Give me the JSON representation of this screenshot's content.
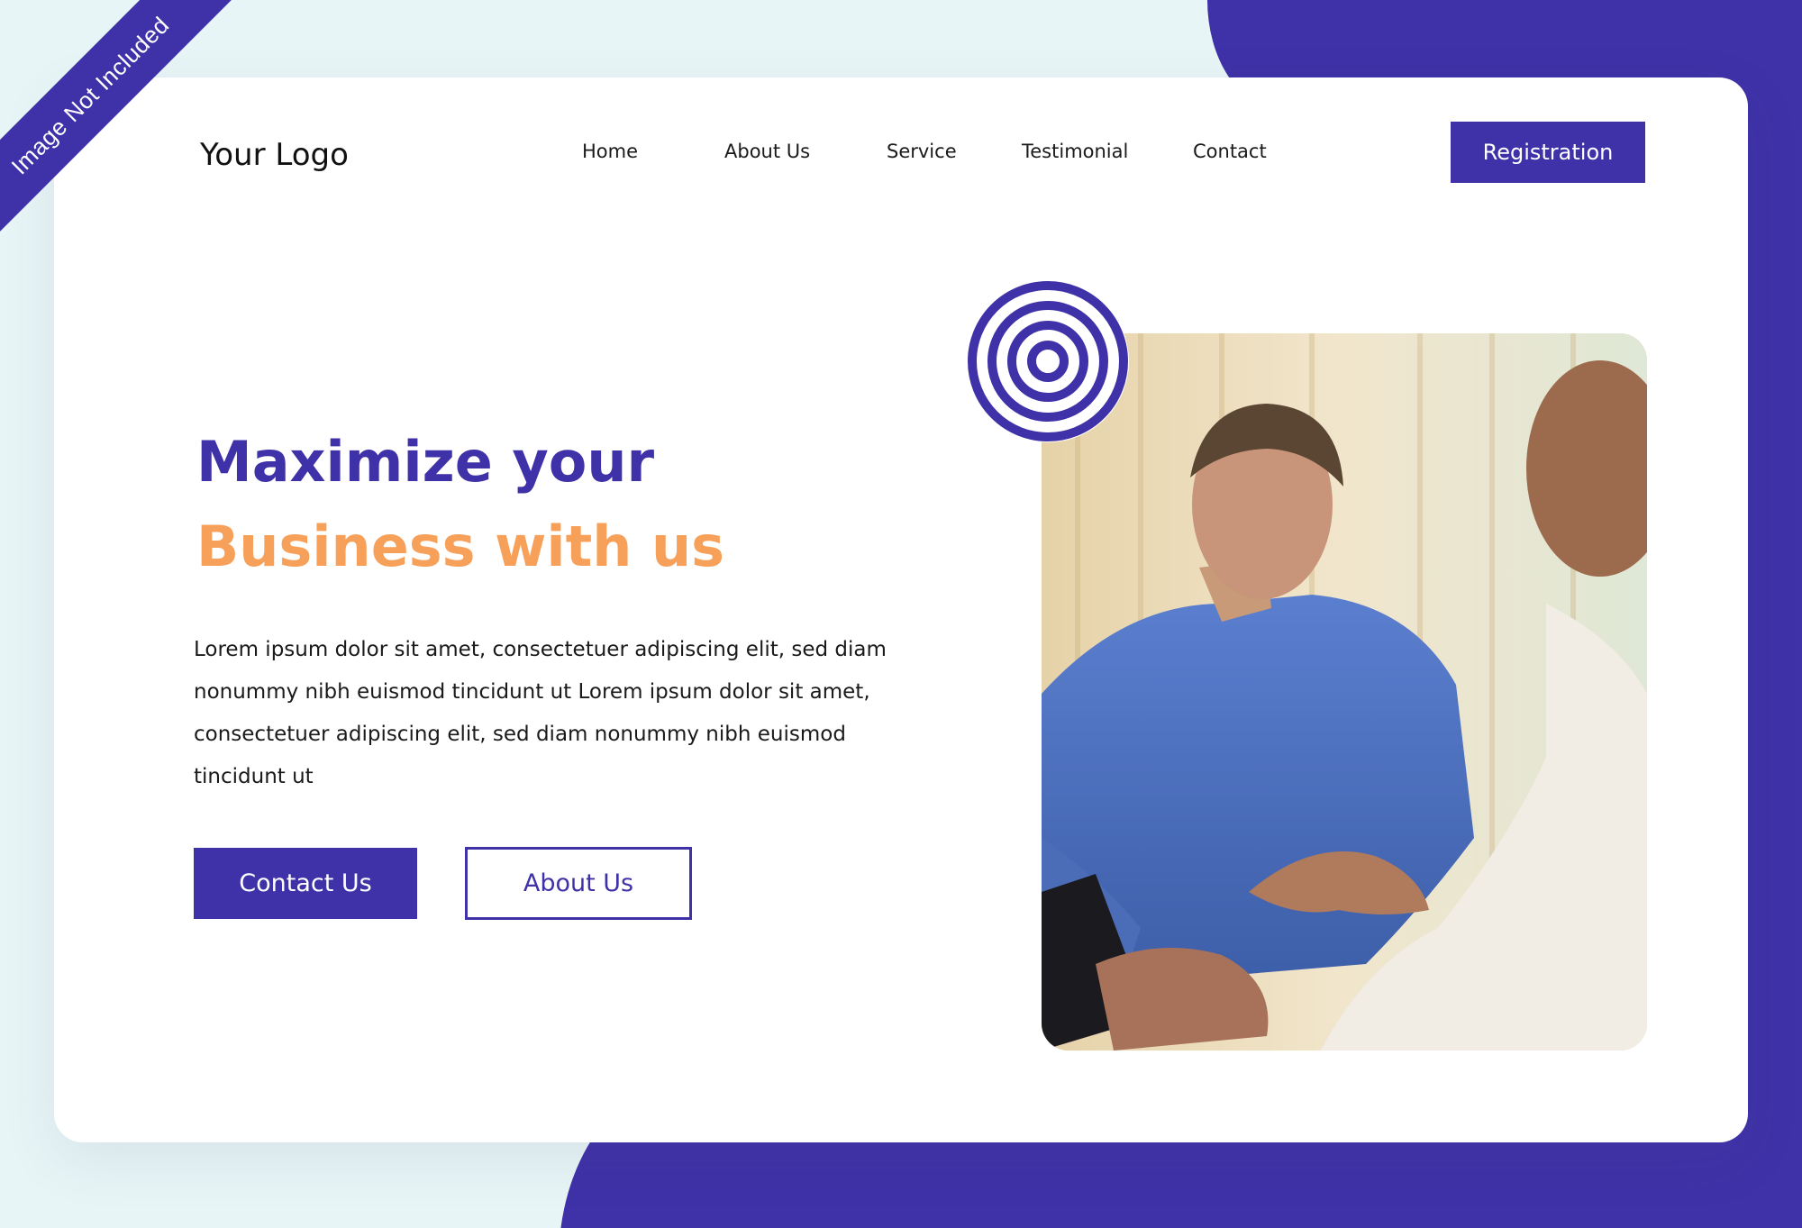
{
  "ribbon": {
    "label": "Image Not Included"
  },
  "header": {
    "logo": "Your Logo",
    "nav": [
      "Home",
      "About Us",
      "Service",
      "Testimonial",
      "Contact"
    ],
    "cta_label": "Registration"
  },
  "hero": {
    "headline_line1": "Maximize your",
    "headline_line2": "Business with us",
    "body": "Lorem ipsum dolor sit amet, consectetuer adipiscing elit, sed diam nonummy nibh euismod tincidunt ut Lorem ipsum dolor sit amet, consectetuer adipiscing elit, sed diam nonummy nibh euismod tincidunt ut",
    "primary_button": "Contact Us",
    "secondary_button": "About Us"
  },
  "colors": {
    "brand_purple": "#3f31a7",
    "accent_orange": "#f6a05a",
    "page_background": "#e8f5f6",
    "card_background": "#ffffff"
  },
  "icons": {
    "rings": "concentric-rings-icon"
  }
}
